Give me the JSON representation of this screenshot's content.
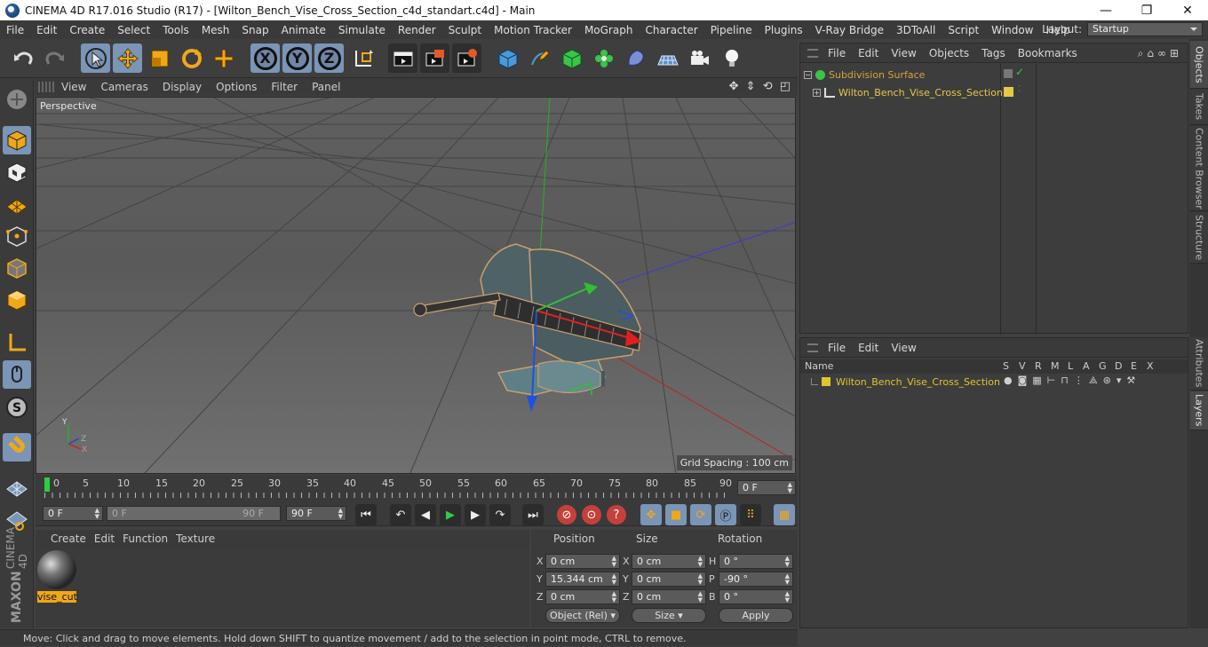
{
  "window": {
    "title": "CINEMA 4D R17.016 Studio (R17) - [Wilton_Bench_Vise_Cross_Section_c4d_standart.c4d] - Main",
    "minimize": "—",
    "maximize": "❐",
    "close": "✕"
  },
  "menubar": {
    "items": [
      "File",
      "Edit",
      "Create",
      "Select",
      "Tools",
      "Mesh",
      "Snap",
      "Animate",
      "Simulate",
      "Render",
      "Sculpt",
      "Motion Tracker",
      "MoGraph",
      "Character",
      "Pipeline",
      "Plugins",
      "V-Ray Bridge",
      "3DToAll",
      "Script",
      "Window",
      "Help"
    ],
    "layout_label": "Layout:",
    "layout_value": "Startup"
  },
  "toolbar": {
    "axis_x": "X",
    "axis_y": "Y",
    "axis_z": "Z"
  },
  "viewport": {
    "menu": [
      "View",
      "Cameras",
      "Display",
      "Options",
      "Filter",
      "Panel"
    ],
    "nav": "✥ ⇕ ⟲ ◰",
    "label": "Perspective",
    "grid_spacing": "Grid Spacing : 100 cm",
    "axis_labels": {
      "y": "Y",
      "z": "Z",
      "x": "X"
    }
  },
  "timeline": {
    "ticks": [
      "0",
      "5",
      "10",
      "15",
      "20",
      "25",
      "30",
      "35",
      "40",
      "45",
      "50",
      "55",
      "60",
      "65",
      "70",
      "75",
      "80",
      "85",
      "90"
    ],
    "current_frame": "0 F",
    "start_field": "0 F",
    "range_start": "0 F",
    "range_end": "90 F",
    "end_field": "90 F"
  },
  "materials": {
    "menu": [
      "Create",
      "Edit",
      "Function",
      "Texture"
    ],
    "items": [
      {
        "name": "vise_cut"
      }
    ]
  },
  "coordinates": {
    "headers": {
      "position": "Position",
      "size": "Size",
      "rotation": "Rotation"
    },
    "rows": [
      {
        "axis": "X",
        "pos": "0 cm",
        "saxis": "X",
        "size": "0 cm",
        "raxis": "H",
        "rot": "0 °"
      },
      {
        "axis": "Y",
        "pos": "15.344 cm",
        "saxis": "Y",
        "size": "0 cm",
        "raxis": "P",
        "rot": "-90 °"
      },
      {
        "axis": "Z",
        "pos": "0 cm",
        "saxis": "Z",
        "size": "0 cm",
        "raxis": "B",
        "rot": "0 °"
      }
    ],
    "mode_select": "Object (Rel)",
    "size_select": "Size",
    "apply": "Apply"
  },
  "status": "Move: Click and drag to move elements. Hold down SHIFT to quantize movement / add to the selection in point mode, CTRL to remove.",
  "objects_panel": {
    "menu": [
      "File",
      "Edit",
      "View",
      "Objects",
      "Tags",
      "Bookmarks"
    ],
    "items": [
      {
        "name": "Subdivision Surface",
        "color": "#d4a53a"
      },
      {
        "name": "Wilton_Bench_Vise_Cross_Section",
        "color": "#e5c84a"
      }
    ]
  },
  "layers_panel": {
    "menu": [
      "File",
      "Edit",
      "View"
    ],
    "columns": [
      "Name",
      "S",
      "V",
      "R",
      "M",
      "L",
      "A",
      "G",
      "D",
      "E",
      "X"
    ],
    "items": [
      {
        "name": "Wilton_Bench_Vise_Cross_Section",
        "color": "#e0c52c"
      }
    ]
  },
  "side_tabs_top": [
    "Objects",
    "Takes",
    "Content Browser",
    "Structure"
  ],
  "side_tabs_bottom": [
    "Attributes",
    "Layers"
  ],
  "brand": {
    "line1": "MAXON",
    "line2": "CINEMA 4D"
  }
}
